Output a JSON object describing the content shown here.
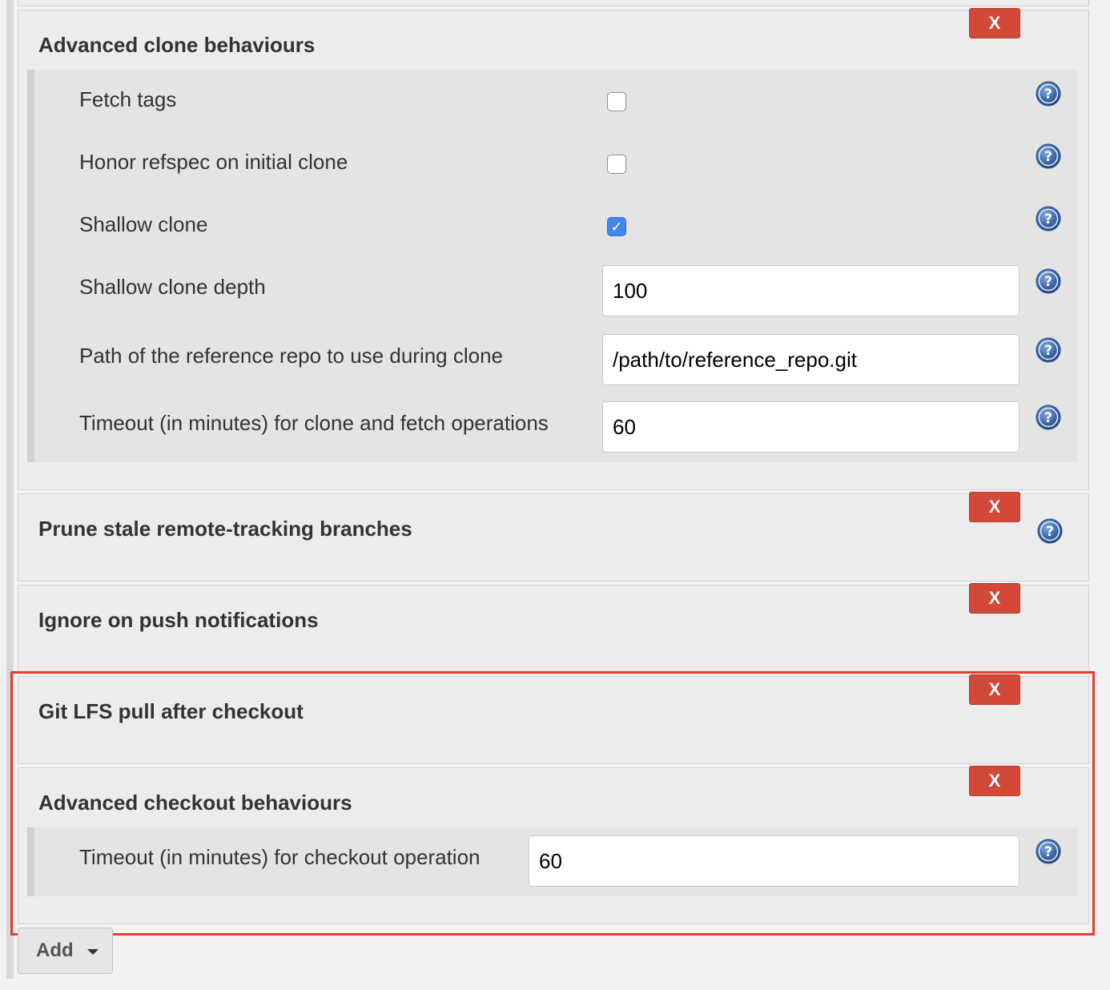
{
  "remove_label": "X",
  "sections": {
    "clone": {
      "title": "Advanced clone behaviours",
      "fetch_tags": {
        "label": "Fetch tags",
        "checked": false
      },
      "honor_refspec": {
        "label": "Honor refspec on initial clone",
        "checked": false
      },
      "shallow_clone": {
        "label": "Shallow clone",
        "checked": true
      },
      "shallow_depth": {
        "label": "Shallow clone depth",
        "value": "100"
      },
      "reference_repo": {
        "label": "Path of the reference repo to use during clone",
        "value": "/path/to/reference_repo.git"
      },
      "timeout": {
        "label": "Timeout (in minutes) for clone and fetch operations",
        "value": "60"
      }
    },
    "prune": {
      "title": "Prune stale remote-tracking branches"
    },
    "ignore_push": {
      "title": "Ignore on push notifications"
    },
    "git_lfs": {
      "title": "Git LFS pull after checkout"
    },
    "checkout": {
      "title": "Advanced checkout behaviours",
      "timeout": {
        "label": "Timeout (in minutes) for checkout operation",
        "value": "60"
      }
    }
  },
  "add_button": {
    "label": "Add"
  },
  "icons": {
    "help": "help-icon",
    "remove": "close-icon",
    "checkmark": "checkmark-icon",
    "dropdown": "caret-down-icon"
  },
  "colors": {
    "remove_button": "#d24939",
    "checkbox_checked": "#3f86f0",
    "help_icon": "#3a66a8",
    "highlight_border": "#e2402f"
  }
}
